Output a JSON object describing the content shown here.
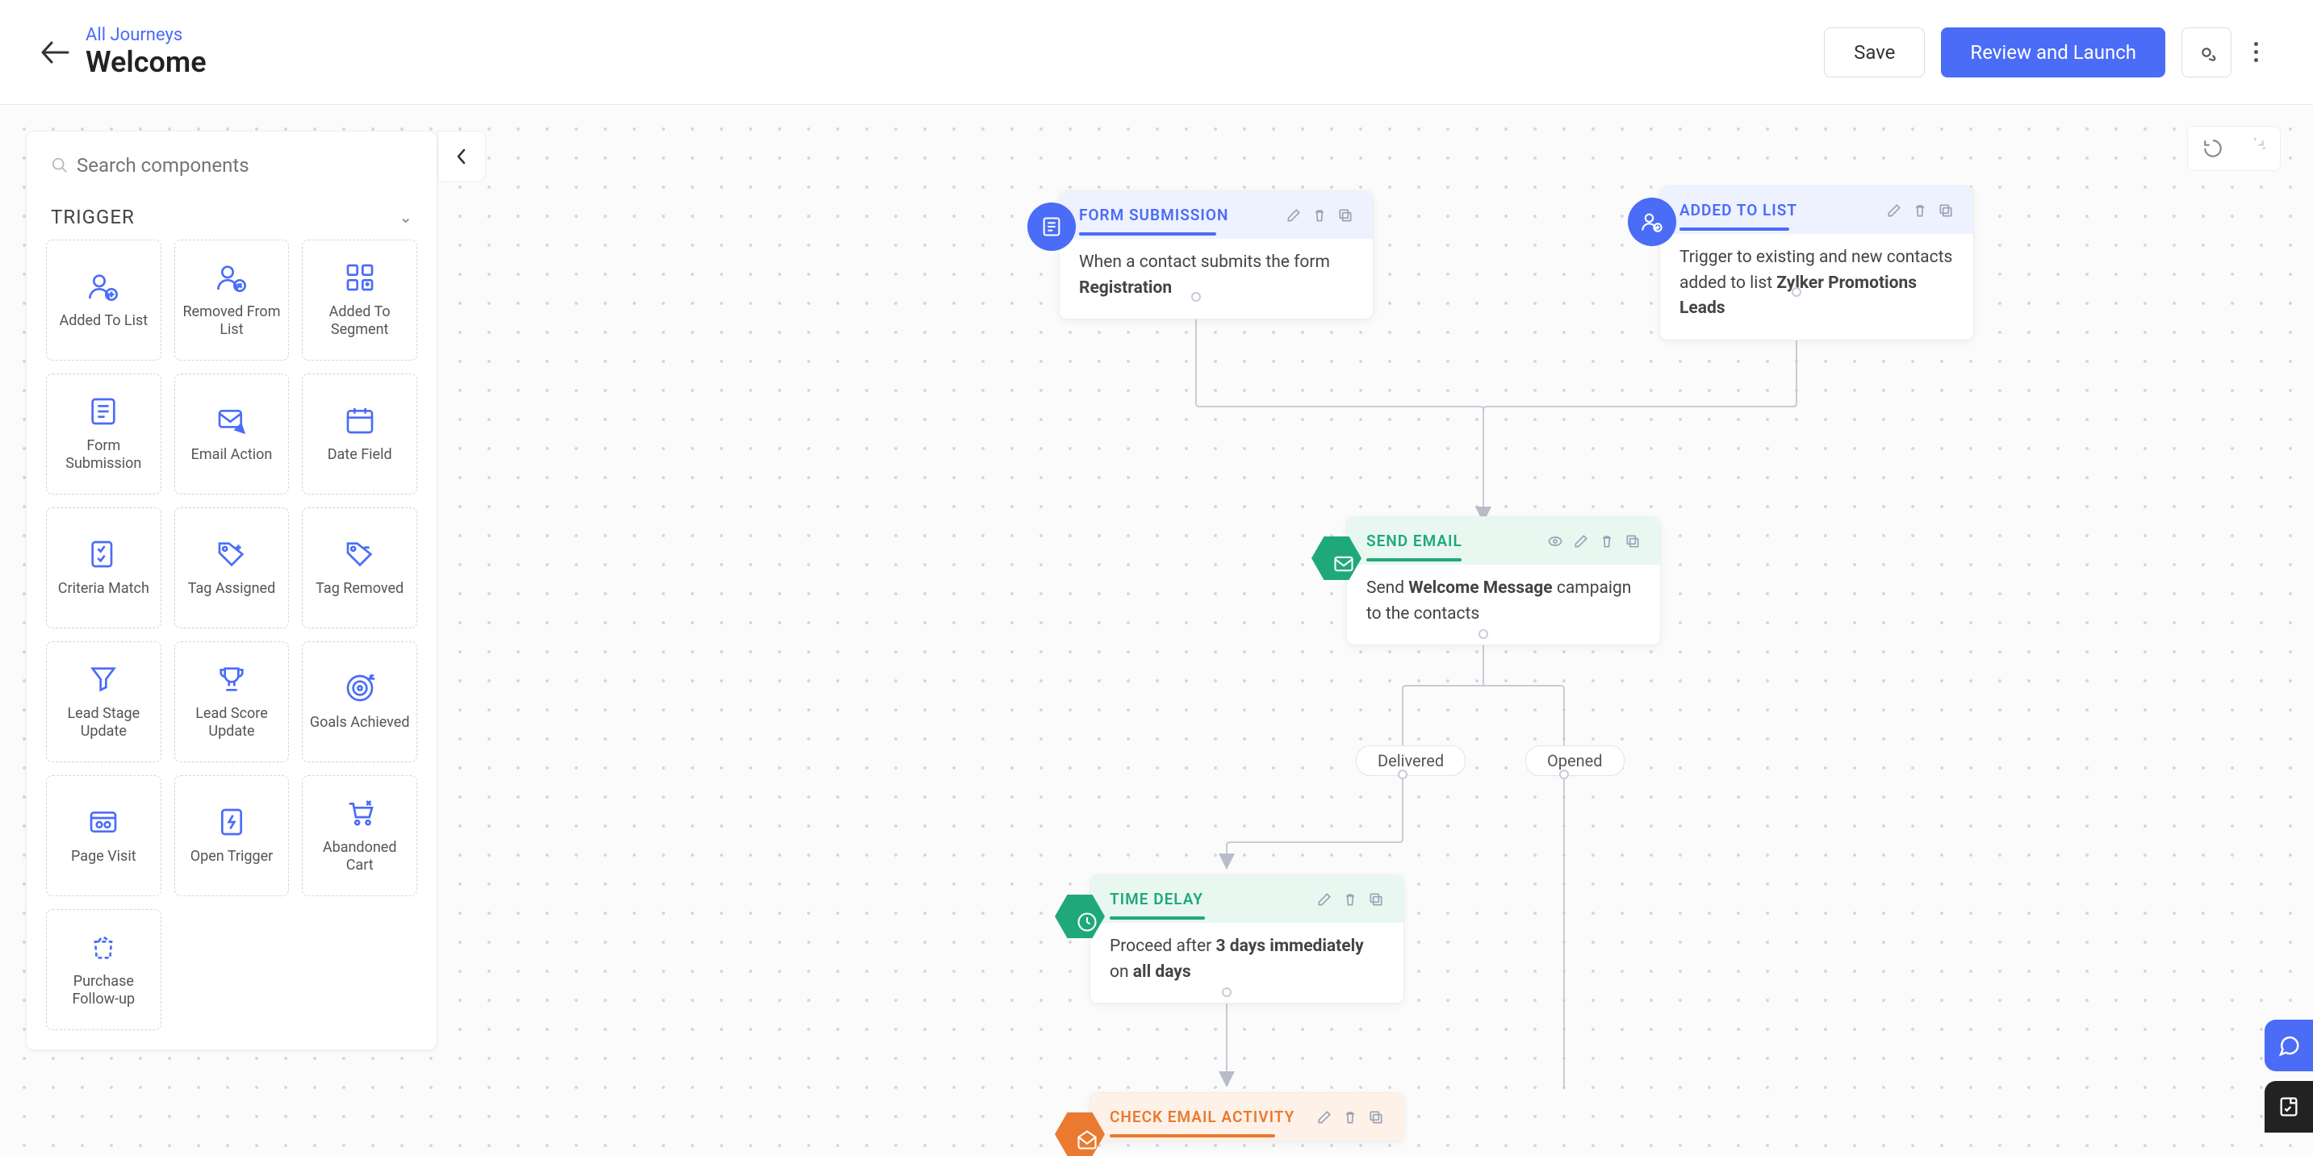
{
  "header": {
    "breadcrumb": "All Journeys",
    "title": "Welcome",
    "save": "Save",
    "review": "Review and Launch"
  },
  "panel": {
    "searchPlaceholder": "Search components",
    "sectionTitle": "TRIGGER",
    "items": [
      "Added To List",
      "Removed From List",
      "Added To Segment",
      "Form Submission",
      "Email Action",
      "Date Field",
      "Criteria Match",
      "Tag Assigned",
      "Tag Removed",
      "Lead Stage Update",
      "Lead Score Update",
      "Goals Achieved",
      "Page Visit",
      "Open Trigger",
      "Abandoned Cart",
      "Purchase Follow-up"
    ]
  },
  "flow": {
    "formSubmission": {
      "title": "FORM SUBMISSION",
      "line1": "When a contact submits the form",
      "bold": "Registration"
    },
    "addedToList": {
      "title": "ADDED TO LIST",
      "line1": "Trigger to existing and new contacts added to list ",
      "bold": "Zylker Promotions Leads"
    },
    "sendEmail": {
      "title": "SEND EMAIL",
      "pre": "Send ",
      "bold": "Welcome Message",
      "post": " campaign to the contacts"
    },
    "branch": {
      "delivered": "Delivered",
      "opened": "Opened"
    },
    "timeDelay": {
      "title": "TIME DELAY",
      "pre": "Proceed after ",
      "bold1": "3 days immediately",
      "mid": " on ",
      "bold2": "all days"
    },
    "checkEmail": {
      "title": "CHECK EMAIL ACTIVITY"
    }
  }
}
